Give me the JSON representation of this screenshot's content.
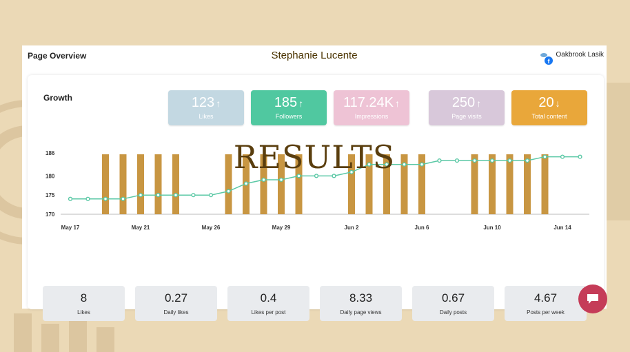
{
  "header": {
    "title": "Page Overview",
    "profile_name": "Stephanie Lucente",
    "brand_name": "Oakbrook Lasik",
    "brand_icon": "facebook-icon"
  },
  "growth": {
    "title": "Growth"
  },
  "stats": [
    {
      "value": "123",
      "label": "Likes",
      "trend": "up",
      "color": "#c3d8e2"
    },
    {
      "value": "185",
      "label": "Followers",
      "trend": "up",
      "color": "#50c8a0"
    },
    {
      "value": "117.24K",
      "label": "Impressions",
      "trend": "up",
      "color": "#eec3d5"
    },
    {
      "value": "250",
      "label": "Page visits",
      "trend": "up",
      "color": "#d8c8da"
    },
    {
      "value": "20",
      "label": "Total content",
      "trend": "down",
      "color": "#e9a73a"
    }
  ],
  "watermark": "RESULTS",
  "metrics": [
    {
      "value": "8",
      "label": "Likes"
    },
    {
      "value": "0.27",
      "label": "Daily likes"
    },
    {
      "value": "0.4",
      "label": "Likes per post"
    },
    {
      "value": "8.33",
      "label": "Daily page views"
    },
    {
      "value": "0.67",
      "label": "Daily posts"
    },
    {
      "value": "4.67",
      "label": "Posts per week"
    }
  ],
  "chart_data": {
    "type": "line",
    "x_tick_labels": [
      "May 17",
      "May 21",
      "May 26",
      "May 29",
      "Jun 2",
      "Jun 6",
      "Jun 10",
      "Jun 14"
    ],
    "y_tick_labels": [
      "170",
      "175",
      "180",
      "186"
    ],
    "ylim": [
      170,
      186
    ],
    "grid": false,
    "legend": "none",
    "series": [
      {
        "values": [
          174,
          174,
          174,
          174,
          175,
          175,
          175,
          175,
          175,
          176,
          178,
          179,
          179,
          180,
          180,
          180,
          181,
          183,
          183,
          183,
          183,
          184,
          184,
          184,
          184,
          184,
          184,
          185,
          185,
          185
        ],
        "color": "#5ac8a5"
      }
    ],
    "bars": {
      "indices": [
        2,
        3,
        4,
        5,
        6,
        9,
        10,
        11,
        12,
        13,
        16,
        17,
        18,
        19,
        20,
        23,
        24,
        25,
        26,
        27
      ],
      "color": "#c89642"
    }
  }
}
